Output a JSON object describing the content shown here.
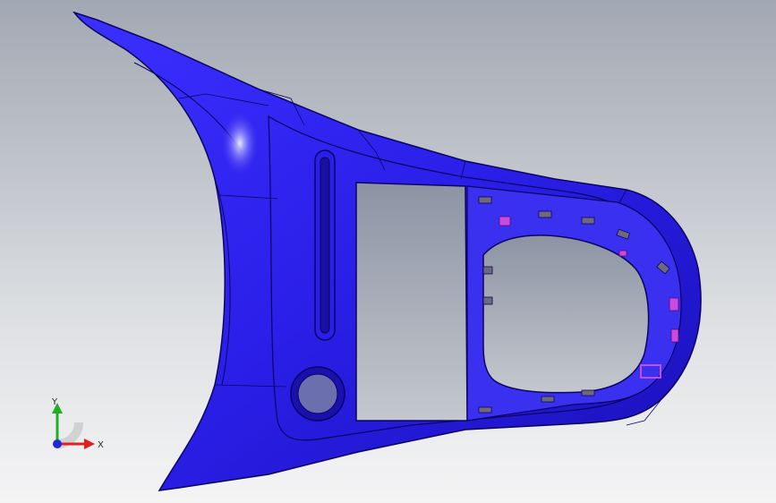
{
  "viewport": {
    "background_top": "#a2a8b3",
    "background_bottom": "#f4f4f5"
  },
  "model": {
    "body_color": "#2a1fe8",
    "edge_color": "#0a0560",
    "cavity_color": "#6b6fae",
    "tab_color": "#6e6a7a",
    "highlight_tab_color": "#c84be0"
  },
  "triad": {
    "x_label": "X",
    "y_label": "Y",
    "x_color": "#e02020",
    "y_color": "#20b020",
    "z_color": "#1e2ad8"
  }
}
